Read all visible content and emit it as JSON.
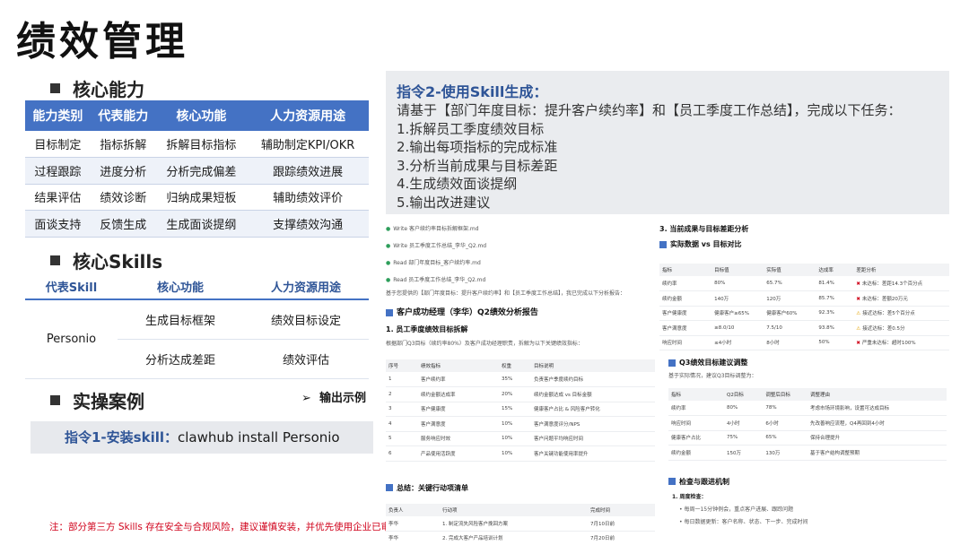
{
  "title": "绩效管理",
  "core_ability": {
    "heading": "核心能力",
    "headers": [
      "能力类别",
      "代表能力",
      "核心功能",
      "人力资源用途"
    ],
    "rows": [
      [
        "目标制定",
        "指标拆解",
        "拆解目标指标",
        "辅助制定KPI/OKR"
      ],
      [
        "过程跟踪",
        "进度分析",
        "分析完成偏差",
        "跟踪绩效进展"
      ],
      [
        "结果评估",
        "绩效诊断",
        "归纳成果短板",
        "辅助绩效评价"
      ],
      [
        "面谈支持",
        "反馈生成",
        "生成面谈提纲",
        "支撑绩效沟通"
      ]
    ]
  },
  "core_skills": {
    "heading": "核心Skills",
    "headers": [
      "代表Skill",
      "核心功能",
      "人力资源用途"
    ],
    "skill": "Personio",
    "rows": [
      [
        "生成目标框架",
        "绩效目标设定"
      ],
      [
        "分析达成差距",
        "绩效评估"
      ]
    ]
  },
  "case": {
    "heading": "实操案例",
    "output_label": "输出示例",
    "cmd1_label": "指令1-安装skill：",
    "cmd1_value": "clawhub install Personio"
  },
  "note": "注：部分第三方 Skills 存在安全与合规风险，建议谨慎安装，并优先使用企业已审核方案。",
  "instruction": {
    "heading": "指令2-使用Skill生成：",
    "lines": [
      "请基于【部门年度目标：提升客户续约率】和【员工季度工作总结】，完成以下任务：",
      "1.拆解员工季度绩效目标",
      "2.输出每项指标的完成标准",
      "3.分析当前成果与目标差距",
      "4.生成绩效面谈提纲",
      "5.输出改进建议"
    ]
  },
  "report": {
    "log_lines": [
      "Write 客户续约率目标拆解框架.md",
      "Write 员工季度工作总结_李华_Q2.md",
      "Read 部门年度目标_客户续约率.md",
      "Read 员工季度工作总结_李华_Q2.md"
    ],
    "intro": "基于您提供的【部门年度目标：提升客户续约率】和【员工季度工作总结】，我已完成以下分析报告：",
    "report_title": "客户成功经理（李华）Q2绩效分析报告",
    "sec1_title": "1. 员工季度绩效目标拆解",
    "sec1_desc": "根据部门Q3目标（续约率80%）及客户成功经理职责，拆解为以下关键绩效指标：",
    "kpi_headers": [
      "序号",
      "绩效指标",
      "权重",
      "目标说明"
    ],
    "kpi_rows": [
      [
        "1",
        "客户续约率",
        "35%",
        "负责客户季度续约目标"
      ],
      [
        "2",
        "续约金额达成率",
        "20%",
        "续约金额达成 vs 目标金额"
      ],
      [
        "3",
        "客户健康度",
        "15%",
        "健康客户占比 & 风险客户转化"
      ],
      [
        "4",
        "客户满意度",
        "10%",
        "客户满意度评分/NPS"
      ],
      [
        "5",
        "服务响应时效",
        "10%",
        "客户问题平均响应时间"
      ],
      [
        "6",
        "产品使用活跃度",
        "10%",
        "客户关键功能使用率提升"
      ]
    ],
    "summary_title": "总结：关键行动项清单",
    "action_headers": [
      "负责人",
      "行动项",
      "完成时间"
    ],
    "action_rows": [
      [
        "李华",
        "1. 制定流失风险客户挽回方案",
        "7月10日前"
      ],
      [
        "李华",
        "2. 完成大客户产品培训计划",
        "7月20日前"
      ]
    ],
    "sec3_title": "3. 当前成果与目标差距分析",
    "actual_title": "实际数据 vs 目标对比",
    "gap_headers": [
      "指标",
      "目标值",
      "实际值",
      "达成率",
      "差距分析"
    ],
    "gap_rows": [
      [
        "续约率",
        "80%",
        "65.7%",
        "81.4%",
        "未达标：差距14.3个百分点"
      ],
      [
        "续约金额",
        "140万",
        "120万",
        "85.7%",
        "未达标：差额20万元"
      ],
      [
        "客户健康度",
        "健康客户≥65%",
        "健康客户60%",
        "92.3%",
        "接近达标：差5个百分点"
      ],
      [
        "客户满意度",
        "≥8.0/10",
        "7.5/10",
        "93.8%",
        "接近达标：差0.5分"
      ],
      [
        "响应时间",
        "≤4小时",
        "8小时",
        "50%",
        "严重未达标：超时100%"
      ]
    ],
    "adjust_title": "Q3绩效目标建议调整",
    "adjust_desc": "基于实际情况，建议Q3目标调整为：",
    "adj_headers": [
      "指标",
      "Q2目标",
      "调整后目标",
      "调整理由"
    ],
    "adj_rows": [
      [
        "续约率",
        "80%",
        "78%",
        "考虑市场环境影响，设置可达成目标"
      ],
      [
        "响应时间",
        "4小时",
        "6小时",
        "先改善响应流程，Q4再回到4小时"
      ],
      [
        "健康客户占比",
        "75%",
        "65%",
        "保持合理提升"
      ],
      [
        "续约金额",
        "150万",
        "130万",
        "基于客户结构调整预期"
      ]
    ],
    "check_title": "检查与跟进机制",
    "check_sub": "1. 周度检查：",
    "check_items": [
      "每周一15分钟例会，重点客户进展、跟踪问题",
      "每日数据更新：客户名称、状态、下一步、完成时间"
    ]
  }
}
